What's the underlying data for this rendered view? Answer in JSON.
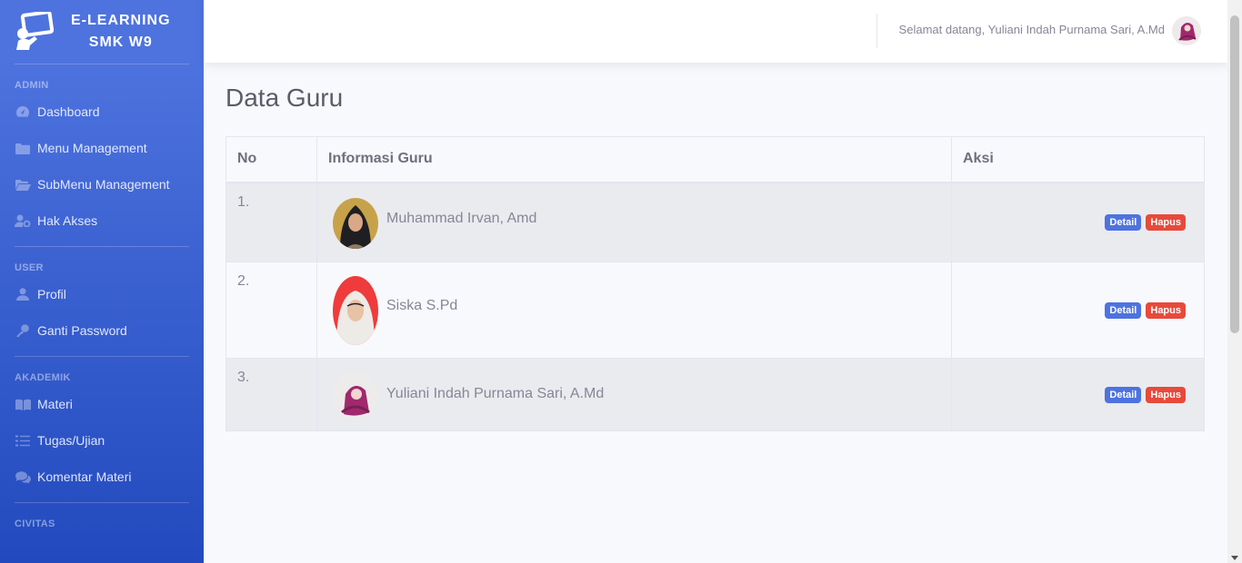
{
  "brand": {
    "line1": "E-LEARNING",
    "line2": "SMK W9"
  },
  "sidebar": {
    "sections": [
      {
        "heading": "ADMIN",
        "items": [
          {
            "label": "Dashboard",
            "icon": "tachometer-icon"
          },
          {
            "label": "Menu Management",
            "icon": "folder-icon"
          },
          {
            "label": "SubMenu Management",
            "icon": "folder-open-icon"
          },
          {
            "label": "Hak Akses",
            "icon": "user-cog-icon"
          }
        ]
      },
      {
        "heading": "USER",
        "items": [
          {
            "label": "Profil",
            "icon": "user-icon"
          },
          {
            "label": "Ganti Password",
            "icon": "key-icon"
          }
        ]
      },
      {
        "heading": "AKADEMIK",
        "items": [
          {
            "label": "Materi",
            "icon": "book-open-icon"
          },
          {
            "label": "Tugas/Ujian",
            "icon": "tasks-icon"
          },
          {
            "label": "Komentar Materi",
            "icon": "comments-icon"
          }
        ]
      },
      {
        "heading": "CIVITAS",
        "items": []
      }
    ]
  },
  "topbar": {
    "welcome": "Selamat datang, Yuliani Indah Purnama Sari, A.Md"
  },
  "page": {
    "title": "Data Guru"
  },
  "table": {
    "headers": {
      "no": "No",
      "info": "Informasi Guru",
      "aksi": "Aksi"
    },
    "rows": [
      {
        "no": "1.",
        "name": "Muhammad Irvan, Amd"
      },
      {
        "no": "2.",
        "name": "Siska S.Pd"
      },
      {
        "no": "3.",
        "name": "Yuliani Indah Purnama Sari, A.Md"
      }
    ],
    "detail_label": "Detail",
    "hapus_label": "Hapus"
  },
  "colors": {
    "primary": "#4e73df",
    "danger": "#e74a3b",
    "sidebar_dark": "#224abe"
  }
}
